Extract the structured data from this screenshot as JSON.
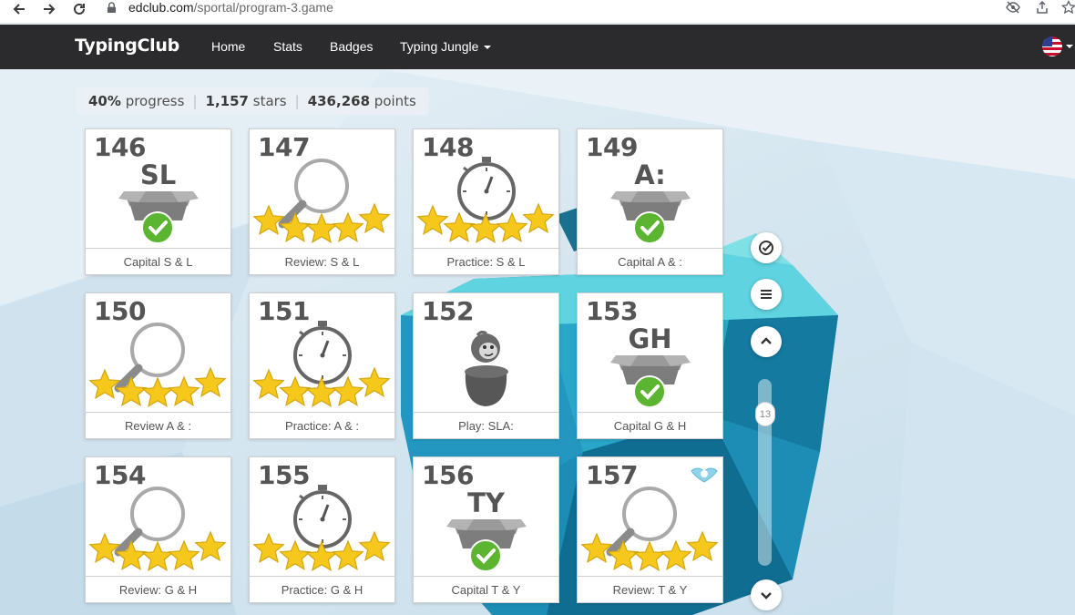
{
  "browser": {
    "url_host": "edclub.com",
    "url_path": "/sportal/program-3.game"
  },
  "site": {
    "brand": "TypingClub",
    "nav": [
      "Home",
      "Stats",
      "Badges",
      "Typing Jungle"
    ]
  },
  "progress": {
    "percent_value": "40%",
    "percent_label": "progress",
    "stars_value": "1,157",
    "stars_label": "stars",
    "points_value": "436,268",
    "points_label": "points"
  },
  "lessons": [
    {
      "number": "146",
      "type": "capital",
      "letters": "SL",
      "label": "Capital S & L"
    },
    {
      "number": "147",
      "type": "review",
      "stars": 5,
      "label": "Review: S & L"
    },
    {
      "number": "148",
      "type": "practice",
      "stars": 5,
      "label": "Practice: S & L"
    },
    {
      "number": "149",
      "type": "capital",
      "letters": "A:",
      "label": "Capital A & :"
    },
    {
      "number": "150",
      "type": "review",
      "stars": 5,
      "label": "Review A & :"
    },
    {
      "number": "151",
      "type": "practice",
      "stars": 5,
      "label": "Practice: A & :"
    },
    {
      "number": "152",
      "type": "play",
      "label": "Play: SLA:"
    },
    {
      "number": "153",
      "type": "capital",
      "letters": "GH",
      "label": "Capital G & H"
    },
    {
      "number": "154",
      "type": "review",
      "stars": 5,
      "label": "Review: G & H"
    },
    {
      "number": "155",
      "type": "practice",
      "stars": 5,
      "label": "Practice: G & H"
    },
    {
      "number": "156",
      "type": "capital",
      "letters": "TY",
      "label": "Capital T & Y"
    },
    {
      "number": "157",
      "type": "review",
      "stars": 5,
      "badge": "bird-badge-icon",
      "label": "Review: T & Y"
    }
  ],
  "controls": {
    "scroll_position": "13"
  },
  "colors": {
    "nav_bg": "#2b2b2e",
    "check_green": "#5cb531",
    "star_gold": "#f6c81b",
    "box_gray": "#9a9a9a"
  }
}
